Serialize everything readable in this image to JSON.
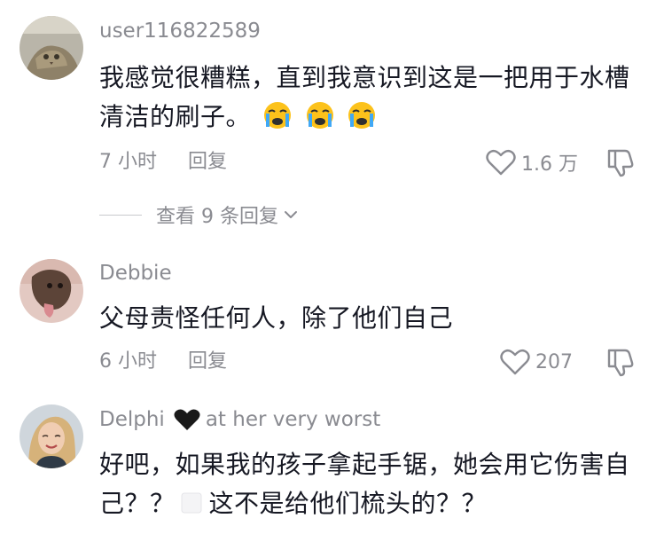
{
  "comments": [
    {
      "username": "user116822589",
      "text_main": "我感觉很糟糕，直到我意识到这是一把用于水槽清洁的刷子。",
      "emoji_names": [
        "loudly-crying-face",
        "loudly-crying-face",
        "loudly-crying-face"
      ],
      "time": "7 小时",
      "reply_label": "回复",
      "likes": "1.6 万"
    },
    {
      "username": "Debbie",
      "text_main": "父母责怪任何人，除了他们自己",
      "time": "6 小时",
      "reply_label": "回复",
      "likes": "207"
    },
    {
      "username_name": "Delphi",
      "username_emoji": "black-heart",
      "username_suffix": "at her very worst",
      "text_main": "好吧，如果我的孩子拿起手锯，她会用它伤害自己？？",
      "text_emoji": "blank-emoji",
      "text_tail": "这不是给他们梳头的？？"
    }
  ],
  "view_replies_label": "查看 9 条回复",
  "colors": {
    "primary_text": "#161823",
    "secondary_text": "#8a8b91",
    "heart_emoji": "#1a1a1a"
  }
}
